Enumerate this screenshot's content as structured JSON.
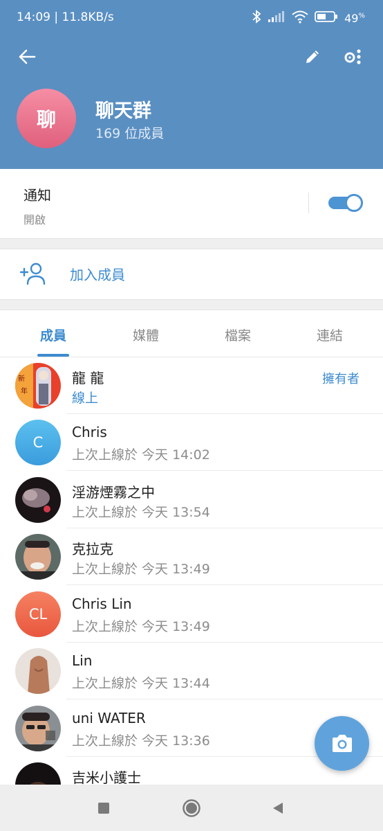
{
  "status_bar": {
    "time_speed": "14:09 | 11.8KB/s",
    "battery": "49",
    "battery_unit": "%"
  },
  "header": {
    "avatar_char": "聊",
    "title": "聊天群",
    "subtitle": "169 位成員",
    "avatar_colors": [
      "#f58ea4",
      "#e0607c"
    ],
    "bg_color": "#5a8fc2"
  },
  "notifications": {
    "title": "通知",
    "status": "開啟",
    "enabled": true
  },
  "add_member": {
    "label": "加入成員"
  },
  "tabs": [
    {
      "label": "成員",
      "active": true
    },
    {
      "label": "媒體",
      "active": false
    },
    {
      "label": "檔案",
      "active": false
    },
    {
      "label": "連結",
      "active": false
    }
  ],
  "members": [
    {
      "name": "龍 龍",
      "status": "線上",
      "role": "擁有者",
      "avatar": "photo",
      "online": true
    },
    {
      "name": "Chris",
      "status": "上次上線於 今天 14:02",
      "avatar_text": "C",
      "avatar_color": "#4aaee6"
    },
    {
      "name": "淫游煙霧之中",
      "status": "上次上線於 今天 13:54",
      "avatar": "photo"
    },
    {
      "name": "克拉克",
      "status": "上次上線於 今天 13:49",
      "avatar": "photo"
    },
    {
      "name": "Chris Lin",
      "status": "上次上線於 今天 13:49",
      "avatar_text": "CL",
      "avatar_color": "#ee6a4d"
    },
    {
      "name": "Lin",
      "status": "上次上線於 今天 13:44",
      "avatar": "photo"
    },
    {
      "name": "uni WATER",
      "status": "上次上線於 今天 13:36",
      "avatar": "photo"
    },
    {
      "name": "吉米小護士",
      "status": "",
      "avatar": "photo"
    }
  ],
  "accent_color": "#3d8bd0",
  "fab": {
    "icon": "camera-icon"
  }
}
